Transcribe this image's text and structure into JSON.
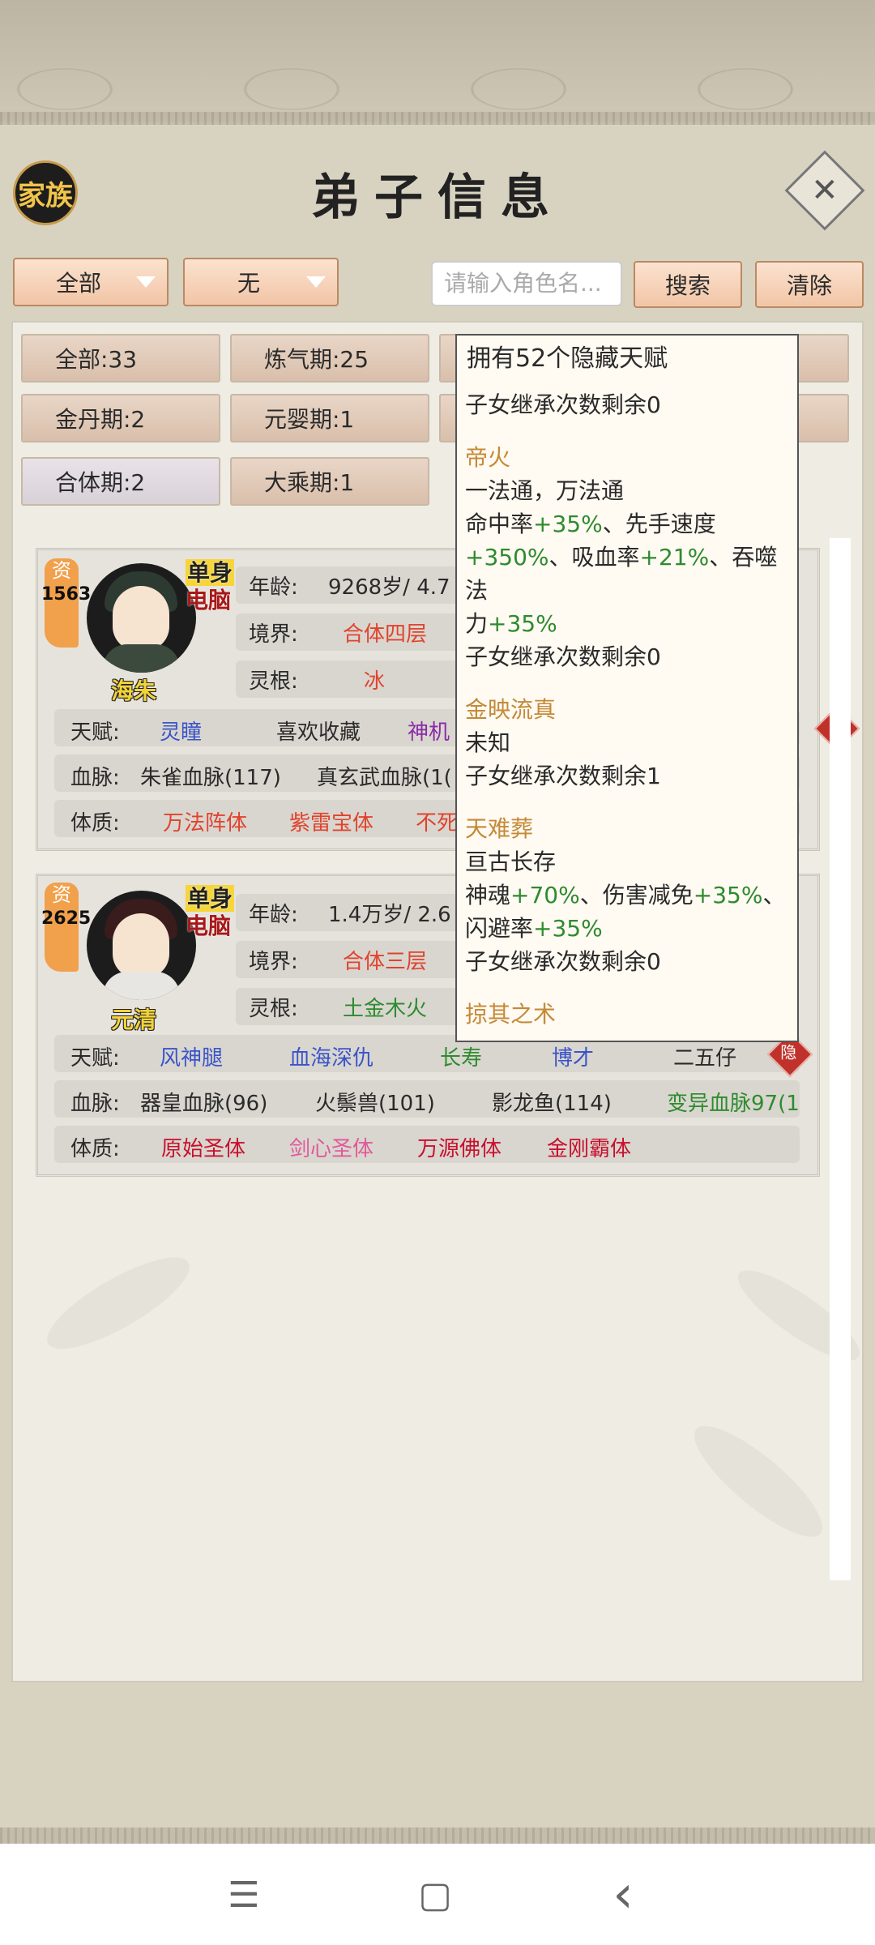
{
  "header": {
    "clan_button": "家族",
    "title": "弟子信息",
    "close_icon": "close-icon"
  },
  "filters": {
    "dropdown1": "全部",
    "dropdown2": "无",
    "search_placeholder": "请输入角色名...",
    "search_button": "搜索",
    "clear_button": "清除"
  },
  "realms": [
    "全部:33",
    "炼气期:25",
    "金丹期:2",
    "元婴期:1",
    "合体期:2",
    "大乘期:1"
  ],
  "disciples": [
    {
      "zi_label": "资",
      "zi_value": "1563",
      "status1": "单身",
      "status2": "电脑",
      "name": "海朱",
      "age_label": "年龄:",
      "age": "9268岁/ 4.7",
      "realm_label": "境界:",
      "realm": "合体四层",
      "root_label": "灵根:",
      "root": "冰",
      "talent_label": "天赋:",
      "talents": [
        "灵瞳",
        "喜欢收藏",
        "神机"
      ],
      "blood_label": "血脉:",
      "bloodlines": [
        "朱雀血脉(117)",
        "真玄武血脉(1("
      ],
      "body_label": "体质:",
      "physiques": [
        "万法阵体",
        "紫雷宝体",
        "不死"
      ]
    },
    {
      "zi_label": "资",
      "zi_value": "2625",
      "status1": "单身",
      "status2": "电脑",
      "name": "元清",
      "age_label": "年龄:",
      "age": "1.4万岁/ 2.6",
      "realm_label": "境界:",
      "realm": "合体三层",
      "root_label": "灵根:",
      "root": "土金木火",
      "talent_label": "天赋:",
      "talents": [
        "风神腿",
        "血海深仇",
        "长寿",
        "博才",
        "二五仔"
      ],
      "blood_label": "血脉:",
      "bloodlines": [
        "器皇血脉(96)",
        "火鬃兽(101)",
        "影龙鱼(114)",
        "变异血脉97(1"
      ],
      "body_label": "体质:",
      "physiques": [
        "原始圣体",
        "剑心圣体",
        "万源佛体",
        "金刚霸体"
      ],
      "hidden_badge": "隐"
    }
  ],
  "popup": {
    "header": "拥有52个隐藏天赋",
    "line0": "子女继承次数剩余0",
    "t1_name": "帝火",
    "t1_desc": "一法通，万法通",
    "t1_a": "命中率",
    "t1_b": "+35%",
    "t1_c": "、先手速度",
    "t1_d": "+350%",
    "t1_e": "、吸血率",
    "t1_f": "+21%",
    "t1_g": "、吞噬法",
    "t1_h": "力",
    "t1_i": "+35%",
    "t1_inherit": "子女继承次数剩余0",
    "t2_name": "金映流真",
    "t2_desc": "未知",
    "t2_inherit": "子女继承次数剩余1",
    "t3_name": "天难葬",
    "t3_desc": "亘古长存",
    "t3_a": "神魂",
    "t3_b": "+70%",
    "t3_c": "、伤害减免",
    "t3_d": "+35%",
    "t3_e": "、",
    "t3_f": "闪避率",
    "t3_g": "+35%",
    "t3_inherit": "子女继承次数剩余0",
    "t4_name": "掠其之术"
  },
  "colors": {
    "blue": "#3a54c8",
    "purple": "#8a2aa8",
    "red": "#e0432e",
    "green": "#2e8b2e",
    "pink": "#e05a9a",
    "gold": "#c48a38"
  },
  "navbar": {
    "menu_icon": "☰",
    "home_icon": "▢",
    "back_icon": "‹"
  }
}
